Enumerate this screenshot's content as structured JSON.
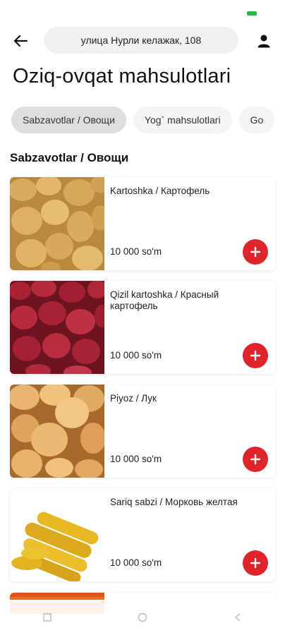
{
  "header": {
    "address": "улица Нурли келажак, 108"
  },
  "page": {
    "title": "Oziq-ovqat mahsulotlari"
  },
  "tabs": [
    {
      "label": "Sabzavotlar / Овощи",
      "active": true
    },
    {
      "label": "Yog` mahsulotlari",
      "active": false
    },
    {
      "label": "Go",
      "active": false
    }
  ],
  "section": {
    "title": "Sabzavotlar / Овощи"
  },
  "products": [
    {
      "name": "Kartoshka / Картофель",
      "price": "10 000 so'm",
      "image": "potato"
    },
    {
      "name": "Qizil kartoshka / Красный картофель",
      "price": "10 000 so'm",
      "image": "red-potato"
    },
    {
      "name": "Piyoz / Лук",
      "price": "10 000 so'm",
      "image": "onion"
    },
    {
      "name": "Sariq sabzi / Морковь желтая",
      "price": "10 000 so'm",
      "image": "yellow-carrot"
    }
  ],
  "colors": {
    "accent": "#e0242c",
    "chip_active": "#dedede",
    "chip": "#f4f4f4"
  }
}
